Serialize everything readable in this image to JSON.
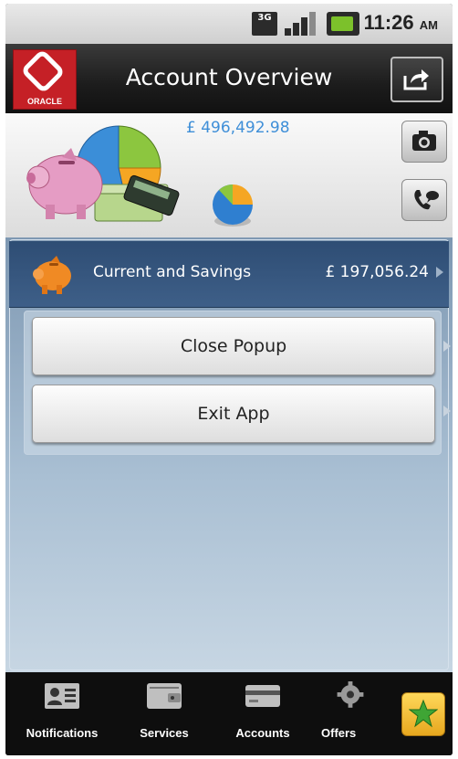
{
  "status_bar": {
    "network": "3G",
    "time": "11:26",
    "ampm": "AM"
  },
  "header": {
    "logo_text": "ORACLE",
    "title": "Account Overview"
  },
  "banner": {
    "total_balance": "£ 496,492.98"
  },
  "account": {
    "name": "Current and Savings",
    "amount": "£ 197,056.24"
  },
  "popup": {
    "close_label": "Close Popup",
    "exit_label": "Exit App"
  },
  "nav": {
    "items": [
      {
        "label": "Notifications",
        "icon": "contact-card-icon"
      },
      {
        "label": "Services",
        "icon": "wallet-icon"
      },
      {
        "label": "Accounts",
        "icon": "credit-card-icon"
      },
      {
        "label": "Offers",
        "icon": "gear-icon"
      }
    ],
    "favorite_icon": "star-icon"
  },
  "colors": {
    "total_text": "#3f8fd8",
    "account_row": "#2e4d74",
    "oracle_red": "#c52026",
    "star_button": "#f2c23a"
  }
}
